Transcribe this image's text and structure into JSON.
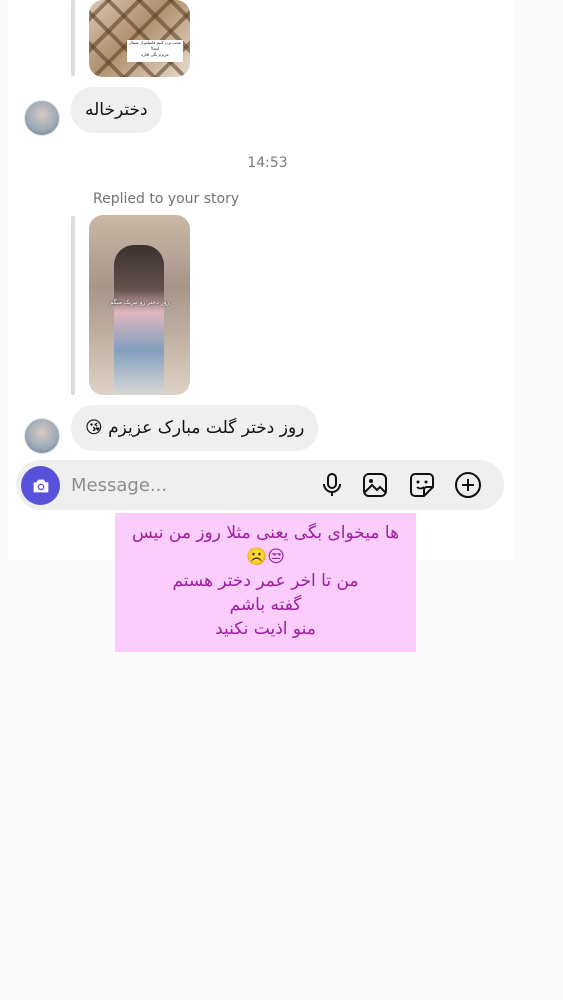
{
  "thread": {
    "messages": [
      {
        "type": "story_reply",
        "text": "دخترخاله"
      },
      {
        "type": "timestamp",
        "text": "14:53"
      },
      {
        "type": "story_reply_label",
        "text": "Replied to your story"
      },
      {
        "type": "story_reply",
        "text": "روز دختر گلت مبارک عزیزم 😘"
      }
    ]
  },
  "story_thumbs": {
    "first_caption_lines": [
      "عجب بزن کنیم فامیلتو از شمال",
      "اینجا!",
      "عزیزم بگی اقاره"
    ],
    "second_caption": "روز دختر رو تبریک میگم"
  },
  "composer": {
    "placeholder": "Message...",
    "icons": [
      "camera-icon",
      "microphone-icon",
      "gallery-icon",
      "sticker-icon",
      "add-icon"
    ],
    "accent": "#5851db"
  },
  "caption_overlay": {
    "background": "#fbcdfc",
    "color": "#9b1fa0",
    "lines": [
      "ها میخوای بگی یعنی مثلا روز من نیس",
      "😒☹️",
      "من تا اخر عمر دختر هستم",
      "گفته باشم",
      "منو اذیت نکنید"
    ]
  }
}
